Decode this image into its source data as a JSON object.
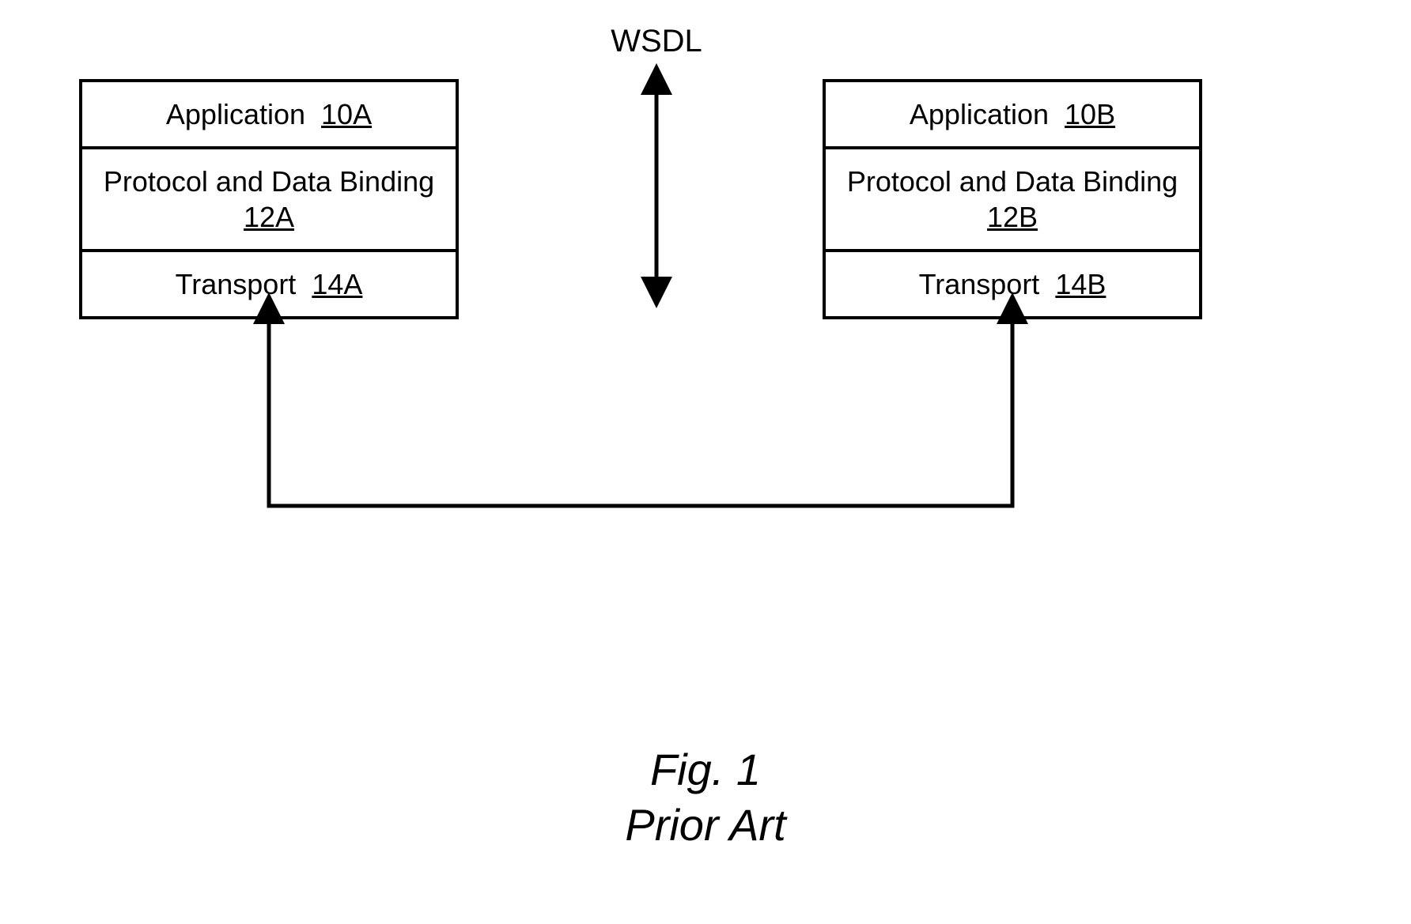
{
  "wsdl_label": "WSDL",
  "left_stack": {
    "app": {
      "label": "Application",
      "ref": "10A"
    },
    "binding": {
      "label": "Protocol and Data Binding",
      "ref": "12A"
    },
    "transport": {
      "label": "Transport",
      "ref": "14A"
    }
  },
  "right_stack": {
    "app": {
      "label": "Application",
      "ref": "10B"
    },
    "binding": {
      "label": "Protocol and Data Binding",
      "ref": "12B"
    },
    "transport": {
      "label": "Transport",
      "ref": "14B"
    }
  },
  "caption": {
    "line1": "Fig. 1",
    "line2": "Prior Art"
  }
}
